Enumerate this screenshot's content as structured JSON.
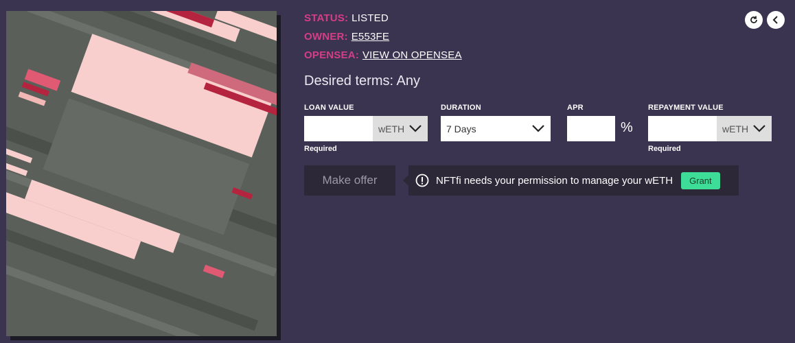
{
  "meta": {
    "status": {
      "label": "STATUS:",
      "value": "LISTED"
    },
    "owner": {
      "label": "OWNER:",
      "value": "E553FE"
    },
    "opensea": {
      "label": "OPENSEA:",
      "value": "VIEW ON OPENSEA"
    }
  },
  "header_buttons": {
    "refresh_icon": "refresh-icon",
    "back_icon": "chevron-left-icon"
  },
  "desired_terms": "Desired terms: Any",
  "form": {
    "loan_value": {
      "label": "LOAN VALUE",
      "value": "",
      "unit": "wETH",
      "hint": "Required"
    },
    "duration": {
      "label": "DURATION",
      "selected": "7 Days"
    },
    "apr": {
      "label": "APR",
      "value": "",
      "suffix": "%"
    },
    "repayment_value": {
      "label": "REPAYMENT VALUE",
      "value": "",
      "unit": "wETH",
      "hint": "Required"
    }
  },
  "actions": {
    "make_offer": "Make offer"
  },
  "notice": {
    "text": "NFTfi needs your permission to manage your wETH",
    "grant_label": "Grant",
    "icon": "exclamation-circle-icon"
  },
  "colors": {
    "background": "#3b3450",
    "accent_pink": "#d63d87",
    "grant_green": "#3ddc97",
    "panel_dark": "#2c2838"
  }
}
